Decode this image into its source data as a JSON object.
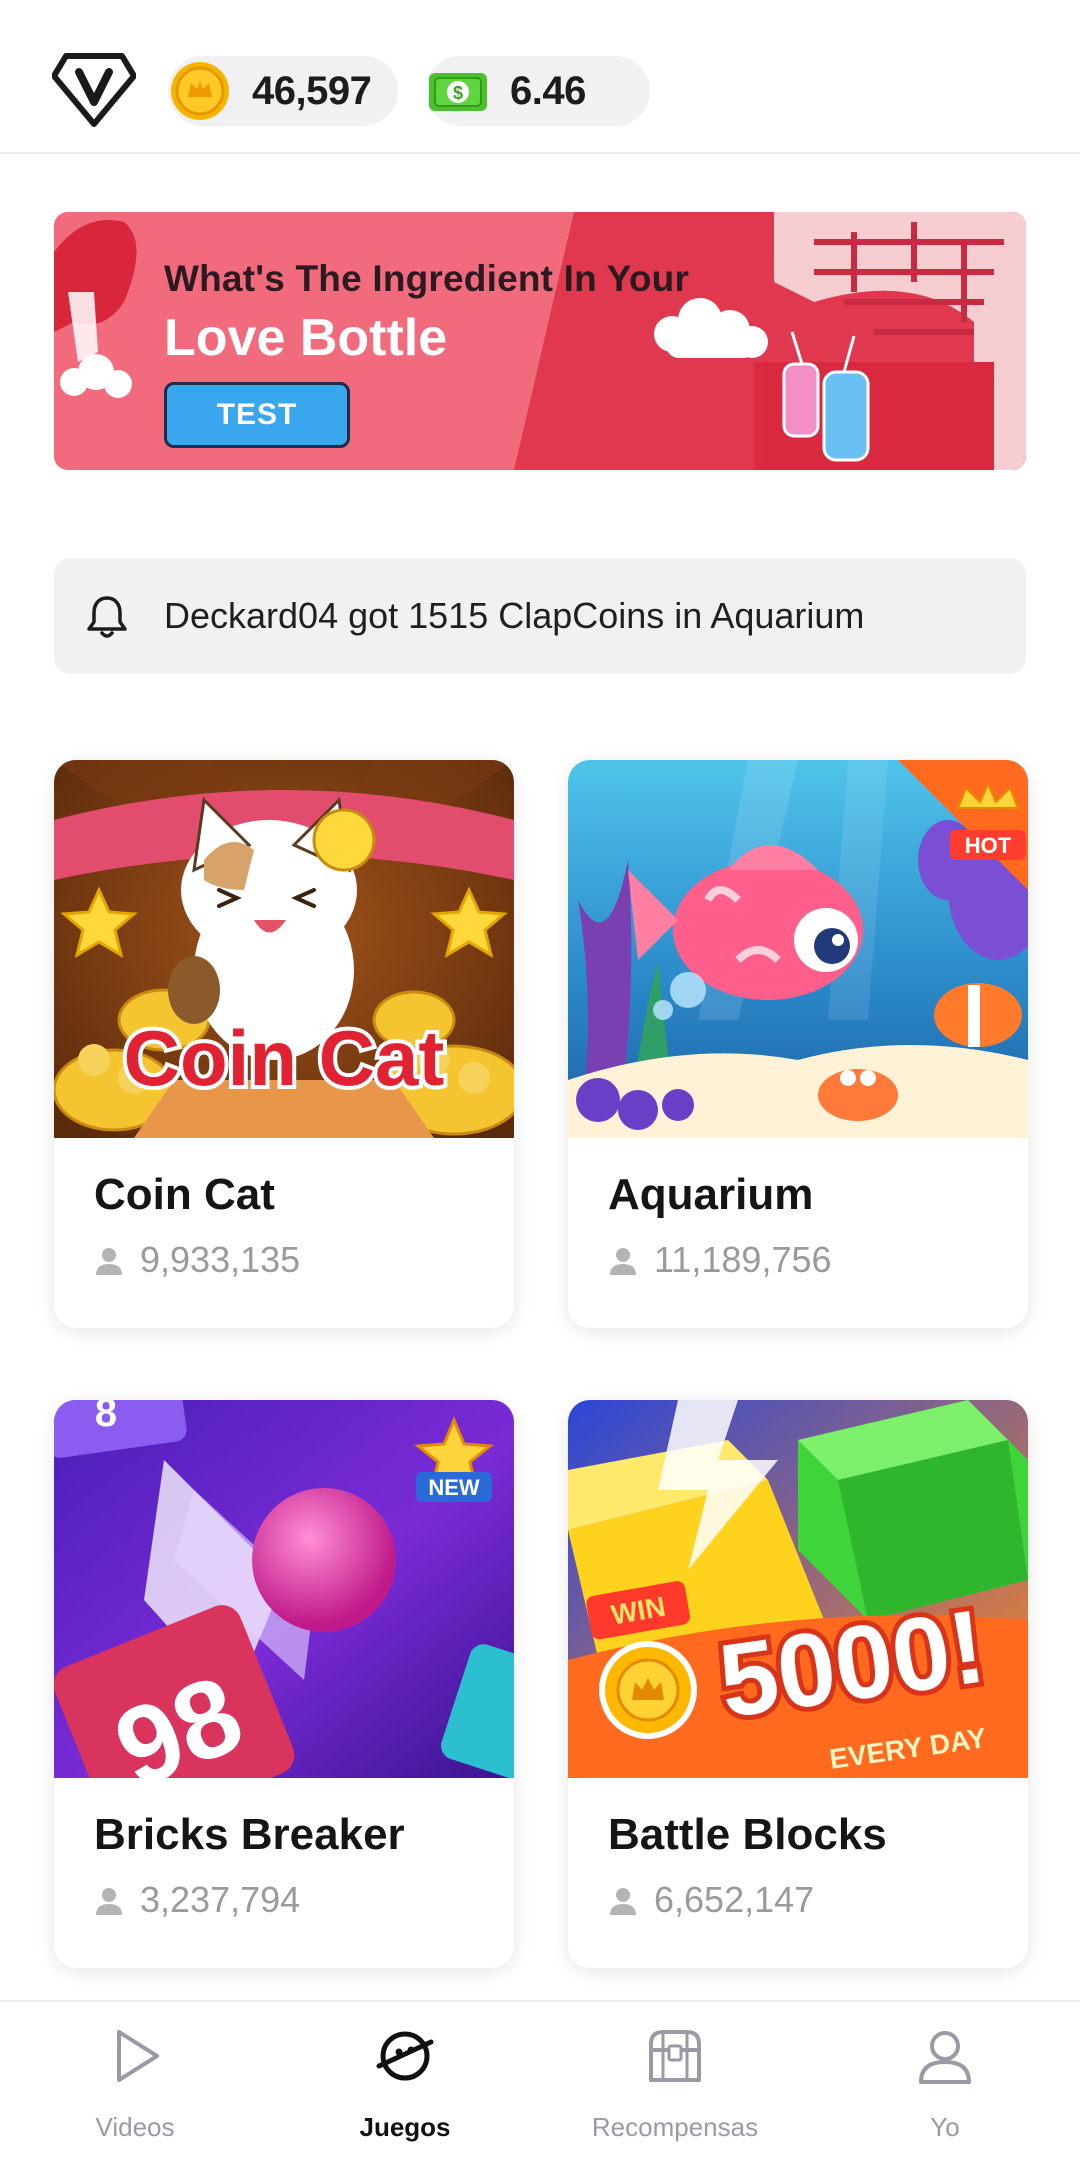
{
  "header": {
    "coins": "46,597",
    "cash": "6.46",
    "icons": [
      "vip-badge-icon",
      "coin-icon",
      "cash-icon"
    ]
  },
  "banner": {
    "line1": "What's The Ingredient In Your",
    "line2": "Love Bottle",
    "button_label": "TEST",
    "colors": {
      "background": "#f26b7d",
      "dark_stripe": "#e0384f",
      "button": "#3aa6ee"
    }
  },
  "notice": {
    "text": "Deckard04 got 1515 ClapCoins in Aquarium",
    "icon": "bell-icon"
  },
  "games": [
    {
      "title": "Coin Cat",
      "players": "9,933,135",
      "art_text": "Coin Cat",
      "badge": ""
    },
    {
      "title": "Aquarium",
      "players": "11,189,756",
      "art_text": "",
      "badge": "HOT"
    },
    {
      "title": "Bricks Breaker",
      "players": "3,237,794",
      "art_text": "98",
      "badge": "NEW"
    },
    {
      "title": "Battle Blocks",
      "players": "6,652,147",
      "art_text": "5000!",
      "art_win": "WIN",
      "art_every_day": "EVERY DAY",
      "badge": ""
    }
  ],
  "bottom_nav": {
    "items": [
      {
        "label": "Videos",
        "icon": "play-icon",
        "active": false
      },
      {
        "label": "Juegos",
        "icon": "planet-icon",
        "active": true
      },
      {
        "label": "Recompensas",
        "icon": "treasure-chest-icon",
        "active": false
      },
      {
        "label": "Yo",
        "icon": "person-icon",
        "active": false
      }
    ]
  }
}
